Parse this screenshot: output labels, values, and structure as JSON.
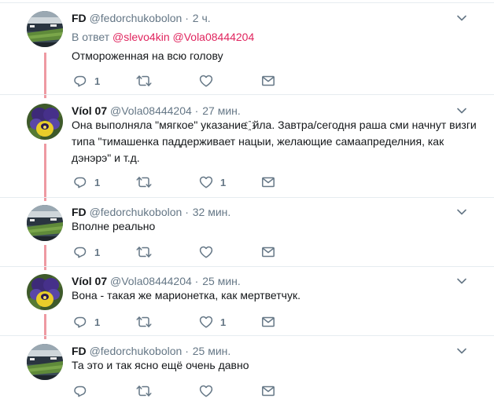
{
  "tweets": [
    {
      "name": "FD",
      "handle": "@fedorchukobolon",
      "sep": "·",
      "time": "2 ч.",
      "reply_label": "В ответ",
      "reply_mentions": [
        "@slevo4kin",
        "@Vola08444204"
      ],
      "text": "Отмороженная на всю голову",
      "reply_count": "1",
      "retweet_count": "",
      "like_count": "",
      "avatar": "stadium-avatar"
    },
    {
      "name": "Víol 07",
      "handle": "@Vola08444204",
      "sep": "·",
      "time": "27 мин.",
      "text": "Она выполняла \"мягкое\" указание ҈ йла. Завтра/сегодня раша сми начнут визги типа \"тимашенка паддерживает нацыи, желающие самаапределния, как дэнэрэ\" и т.д.",
      "reply_count": "1",
      "retweet_count": "",
      "like_count": "1",
      "avatar": "pansy-avatar"
    },
    {
      "name": "FD",
      "handle": "@fedorchukobolon",
      "sep": "·",
      "time": "32 мин.",
      "text": "Вполне реально",
      "reply_count": "1",
      "retweet_count": "",
      "like_count": "",
      "avatar": "stadium-avatar"
    },
    {
      "name": "Víol 07",
      "handle": "@Vola08444204",
      "sep": "·",
      "time": "25 мин.",
      "text": "Вона - такая же марионетка, как мертветчук.",
      "reply_count": "1",
      "retweet_count": "",
      "like_count": "1",
      "avatar": "pansy-avatar"
    },
    {
      "name": "FD",
      "handle": "@fedorchukobolon",
      "sep": "·",
      "time": "25 мин.",
      "text": "Та это и так ясно ещё очень давно",
      "reply_count": "",
      "retweet_count": "",
      "like_count": "",
      "avatar": "stadium-avatar"
    }
  ],
  "colors": {
    "text": "#14171a",
    "secondary": "#657786",
    "mention": "#e0245e",
    "thread_line": "#ee9aa2",
    "divider": "#e6ecf0"
  }
}
